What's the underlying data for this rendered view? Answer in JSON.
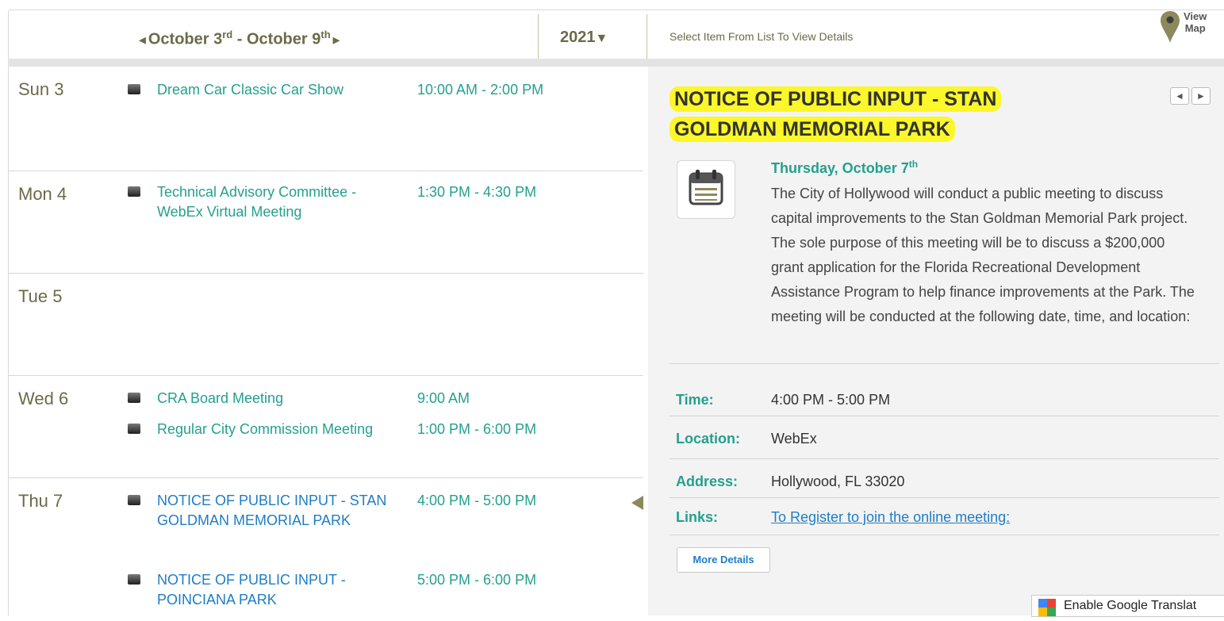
{
  "nav": {
    "prev_arrow": "◄",
    "week_start": "October 3",
    "week_start_sup": "rd",
    "week_sep": " - October 9",
    "week_end_sup": "th",
    "next_arrow": "►",
    "year": "2021",
    "year_caret": "▼",
    "select_hint": "Select Item From List To View Details",
    "view_map_line1": "View",
    "view_map_line2": "Map"
  },
  "days": [
    {
      "label": "Sun 3",
      "events": [
        {
          "title": "Dream Car Classic Car Show",
          "time": "10:00 AM - 2:00 PM"
        }
      ]
    },
    {
      "label": "Mon 4",
      "events": [
        {
          "title": "Technical Advisory Committee - WebEx Virtual Meeting",
          "time": "1:30 PM - 4:30 PM"
        }
      ]
    },
    {
      "label": "Tue 5",
      "events": []
    },
    {
      "label": "Wed 6",
      "events": [
        {
          "title": "CRA Board Meeting",
          "time": "9:00 AM"
        },
        {
          "title": "Regular City Commission Meeting",
          "time": "1:00 PM - 6:00 PM"
        }
      ]
    },
    {
      "label": "Thu 7",
      "events": [
        {
          "title": "NOTICE OF PUBLIC INPUT - STAN GOLDMAN MEMORIAL PARK",
          "time": "4:00 PM - 5:00 PM"
        },
        {
          "title": "NOTICE OF PUBLIC INPUT - POINCIANA PARK",
          "time": "5:00 PM - 6:00 PM"
        }
      ]
    }
  ],
  "detail": {
    "title": "NOTICE OF PUBLIC INPUT - STAN GOLDMAN MEMORIAL PARK",
    "prev_btn": "◄",
    "next_btn": "►",
    "date": "Thursday, October 7",
    "date_sup": "th",
    "description": "The City of Hollywood will conduct a public meeting to discuss capital improvements to the Stan Goldman Memorial Park project. The sole purpose of this meeting will be to discuss a $200,000 grant application for the Florida Recreational Development Assistance Program to help finance improvements at the Park. The meeting will be conducted at the following date, time, and location:",
    "fields": {
      "time_label": "Time:",
      "time_value": "4:00 PM - 5:00 PM",
      "location_label": "Location:",
      "location_value": "WebEx",
      "address_label": "Address:",
      "address_value": "Hollywood, FL 33020",
      "links_label": "Links:",
      "links_value": "To Register to join the online meeting:"
    },
    "more_details": "More Details"
  },
  "translate": {
    "label": "Enable Google Translat"
  },
  "colors": {
    "accent": "#24a08e",
    "link": "#1f7dc6",
    "olive": "#6b6b49",
    "highlight": "#fbf72a"
  }
}
